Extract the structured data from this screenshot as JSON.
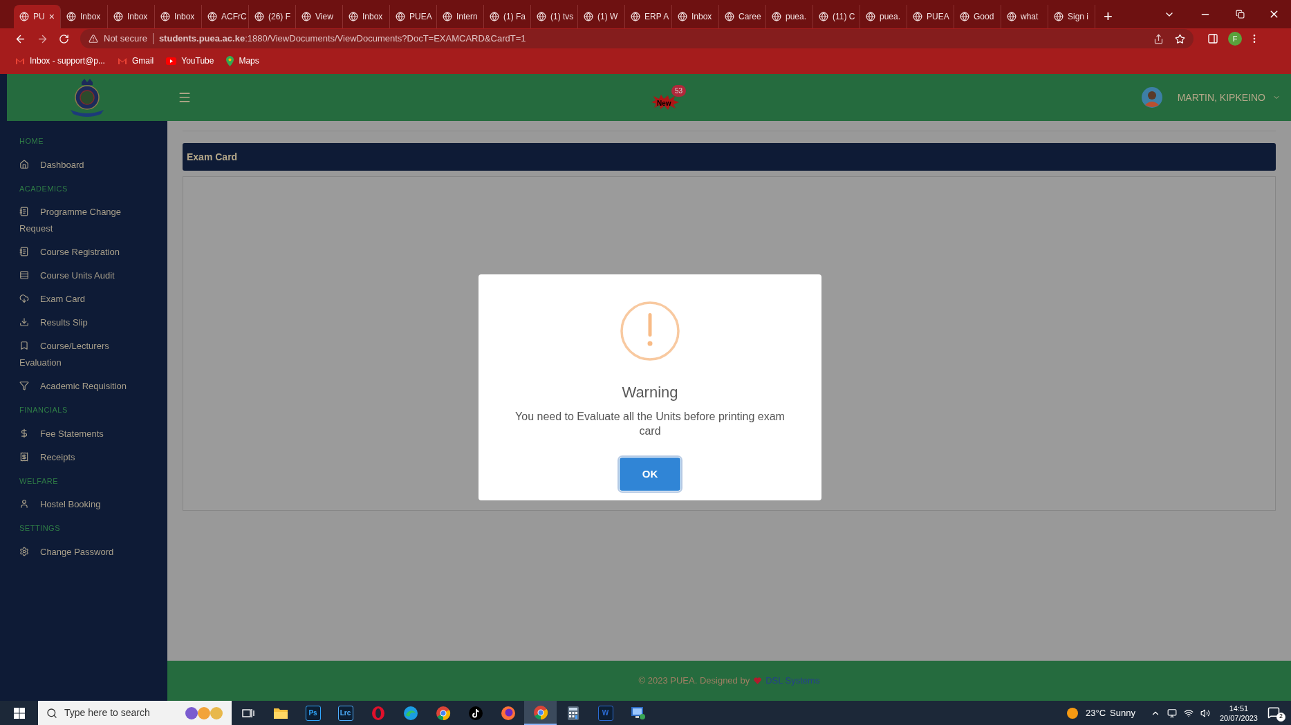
{
  "browser": {
    "tabs": [
      {
        "label": "PU",
        "selected": true,
        "close": "×"
      },
      {
        "label": "Inbox",
        "selected": false
      },
      {
        "label": "Inbox",
        "selected": false
      },
      {
        "label": "Inbox",
        "selected": false
      },
      {
        "label": "ACFrC",
        "selected": false
      },
      {
        "label": "(26) F",
        "selected": false
      },
      {
        "label": "View",
        "selected": false
      },
      {
        "label": "Inbox",
        "selected": false
      },
      {
        "label": "PUEA",
        "selected": false
      },
      {
        "label": "Intern",
        "selected": false
      },
      {
        "label": "(1) Fa",
        "selected": false
      },
      {
        "label": "(1) tvs",
        "selected": false
      },
      {
        "label": "(1) W",
        "selected": false
      },
      {
        "label": "ERP A",
        "selected": false
      },
      {
        "label": "Inbox",
        "selected": false
      },
      {
        "label": "Caree",
        "selected": false
      },
      {
        "label": "puea.",
        "selected": false
      },
      {
        "label": "(11) C",
        "selected": false
      },
      {
        "label": "puea.",
        "selected": false
      },
      {
        "label": "PUEA",
        "selected": false
      },
      {
        "label": "Good",
        "selected": false
      },
      {
        "label": "what",
        "selected": false
      },
      {
        "label": "Sign i",
        "selected": false
      }
    ],
    "new_tab": "+",
    "security": "Not secure",
    "url": "**students.puea.ac.ke**:1880/ViewDocuments/ViewDocuments?DocT=EXAMCARD&CardT=1",
    "profile": "F",
    "bookmarks": [
      {
        "label": "Inbox - support@p...",
        "kind": "mail"
      },
      {
        "label": "Gmail",
        "kind": "mail"
      },
      {
        "label": "YouTube",
        "kind": "video"
      },
      {
        "label": "Maps",
        "kind": "map"
      }
    ]
  },
  "header": {
    "notification_image_text": "New",
    "notification_count": "53",
    "user": "MARTIN, KIPKEINO"
  },
  "sidebar": {
    "sections": [
      {
        "title": "HOME",
        "items": [
          {
            "label": "Dashboard"
          }
        ]
      },
      {
        "title": "ACADEMICS",
        "items": [
          {
            "label": "Programme Change Request"
          },
          {
            "label": "Course Registration"
          },
          {
            "label": "Course Units Audit"
          },
          {
            "label": "Exam Card"
          },
          {
            "label": "Results Slip"
          },
          {
            "label": "Course/Lecturers Evaluation"
          },
          {
            "label": "Academic Requisition"
          }
        ]
      },
      {
        "title": "FINANCIALS",
        "items": [
          {
            "label": "Fee Statements"
          },
          {
            "label": "Receipts"
          }
        ]
      },
      {
        "title": "WELFARE",
        "items": [
          {
            "label": "Hostel Booking"
          }
        ]
      },
      {
        "title": "SETTINGS",
        "items": [
          {
            "label": "Change Password"
          }
        ]
      }
    ]
  },
  "page": {
    "title": "Exam Card"
  },
  "dialog": {
    "title": "Warning",
    "message": "You need to Evaluate all the Units before printing exam card",
    "button": "OK"
  },
  "footer": {
    "text": "© 2023 PUEA. Designed by",
    "link": "DSL Systems"
  },
  "taskbar": {
    "search_placeholder": "Type here to search",
    "apps": [
      {
        "kind": "taskview",
        "selected": false
      },
      {
        "kind": "folder",
        "selected": false
      },
      {
        "kind": "tile",
        "label": "Ps",
        "color": "#31a8ff",
        "selected": false
      },
      {
        "kind": "tile",
        "label": "Lrc",
        "color": "#4fb0ff",
        "selected": false
      },
      {
        "kind": "opera",
        "selected": false
      },
      {
        "kind": "edge",
        "selected": false
      },
      {
        "kind": "chrome",
        "selected": false
      },
      {
        "kind": "tiktok",
        "selected": false
      },
      {
        "kind": "firefox",
        "selected": false
      },
      {
        "kind": "chrome",
        "selected": true
      },
      {
        "kind": "calculator",
        "selected": false
      },
      {
        "kind": "tile",
        "label": "W",
        "color": "#2b6cd4",
        "selected": false
      },
      {
        "kind": "remote",
        "selected": false
      }
    ],
    "temperature": "23°C",
    "weather": "Sunny",
    "time": "14:51",
    "date": "20/07/2023",
    "notifications": "2"
  }
}
